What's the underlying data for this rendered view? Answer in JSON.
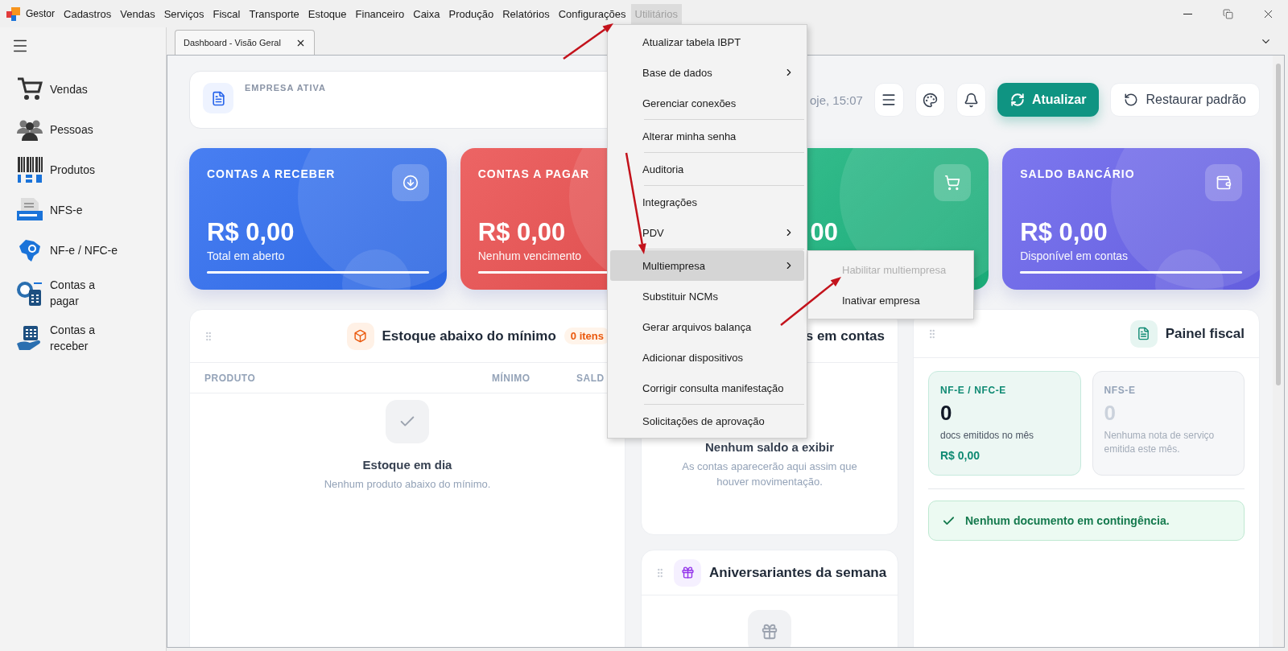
{
  "window": {
    "app_name": "Gestor"
  },
  "menu_bar": [
    {
      "label": "Cadastros",
      "selected": false
    },
    {
      "label": "Vendas",
      "selected": false
    },
    {
      "label": "Serviços",
      "selected": false
    },
    {
      "label": "Fiscal",
      "selected": false
    },
    {
      "label": "Transporte",
      "selected": false
    },
    {
      "label": "Estoque",
      "selected": false
    },
    {
      "label": "Financeiro",
      "selected": false
    },
    {
      "label": "Caixa",
      "selected": false
    },
    {
      "label": "Produção",
      "selected": false
    },
    {
      "label": "Relatórios",
      "selected": false
    },
    {
      "label": "Configurações",
      "selected": false
    },
    {
      "label": "Utilitários",
      "selected": true
    }
  ],
  "sidebar": {
    "items": [
      {
        "kind": "cart",
        "label": "Vendas"
      },
      {
        "kind": "people",
        "label": "Pessoas"
      },
      {
        "kind": "barcode",
        "label": "Produtos"
      },
      {
        "kind": "nfse",
        "label": "NFS-e"
      },
      {
        "kind": "nfe",
        "label": "NF-e / NFC-e"
      },
      {
        "kind": "payable",
        "label": "Contas a pagar"
      },
      {
        "kind": "receivable",
        "label": "Contas a receber"
      }
    ]
  },
  "tabs": [
    {
      "label": "Dashboard - Visão Geral",
      "selected": true
    }
  ],
  "header": {
    "label": "EMPRESA ATIVA",
    "date": "oje, 15:07",
    "buttons": [
      {
        "kind": "menu"
      },
      {
        "kind": "palette"
      },
      {
        "kind": "bell"
      },
      {
        "kind": "primary",
        "label": "Atualizar"
      },
      {
        "kind": "secondary",
        "label": "Restaurar padrão"
      }
    ]
  },
  "kpis": [
    {
      "title": "CONTAS A RECEBER",
      "value": "R$ 0,00",
      "subtitle": "Total em aberto",
      "kind": "download",
      "color": "#2f6df0",
      "level": 1
    },
    {
      "title": "CONTAS A PAGAR",
      "value": "R$ 0,00",
      "subtitle": "Nenhum vencimento",
      "kind": "plain",
      "color": "#ea4f4f",
      "level": 1
    },
    {
      "value": "00",
      "kind": "cart",
      "color": "#1cb57f",
      "obscured": true
    },
    {
      "title": "SALDO BANCÁRIO",
      "value": "R$ 0,00",
      "subtitle": "Disponível em contas",
      "kind": "wallet",
      "color": "#6a64ec",
      "level": 1
    }
  ],
  "stock_panel": {
    "title": "Estoque abaixo do mínimo",
    "badge": "0 itens",
    "columns": [
      "PRODUTO",
      "MÍNIMO",
      "SALD"
    ],
    "empty_title": "Estoque em dia",
    "empty_text": "Nenhum produto abaixo do mínimo."
  },
  "balances_panel": {
    "title": "s em contas",
    "empty_title": "Nenhum saldo a exibir",
    "empty_text": "As contas aparecerão aqui assim que houver movimentação."
  },
  "birthdays_panel": {
    "title": "Aniversariantes da semana"
  },
  "fiscal_panel": {
    "title": "Painel fiscal",
    "boxes": [
      {
        "title": "NF-E / NFC-E",
        "count": "0",
        "text": "docs emitidos no mês",
        "amount": "R$ 0,00",
        "active": true
      },
      {
        "title": "NFS-E",
        "count": "0",
        "text": "Nenhuma nota de serviço emitida este mês.",
        "active": false
      }
    ],
    "alert": "Nenhum documento em contingência."
  },
  "menu": {
    "items": [
      {
        "kind": "item",
        "label": "Atualizar tabela IBPT",
        "has_submenu": false,
        "selected": false
      },
      {
        "kind": "item",
        "label": "Base de dados",
        "has_submenu": true,
        "selected": false
      },
      {
        "kind": "item",
        "label": "Gerenciar conexões",
        "has_submenu": false,
        "selected": false
      },
      {
        "kind": "separator"
      },
      {
        "kind": "item",
        "label": "Alterar minha senha",
        "has_submenu": false,
        "selected": false
      },
      {
        "kind": "separator"
      },
      {
        "kind": "item",
        "label": "Auditoria",
        "has_submenu": false,
        "selected": false
      },
      {
        "kind": "separator"
      },
      {
        "kind": "item",
        "label": "Integrações",
        "has_submenu": false,
        "selected": false
      },
      {
        "kind": "item",
        "label": "PDV",
        "has_submenu": true,
        "selected": false
      },
      {
        "kind": "separator"
      },
      {
        "kind": "item",
        "label": "Multiempresa",
        "has_submenu": true,
        "selected": true
      },
      {
        "kind": "item",
        "label": "Substituir NCMs",
        "has_submenu": false,
        "selected": false
      },
      {
        "kind": "item",
        "label": "Gerar arquivos balança",
        "has_submenu": false,
        "selected": false
      },
      {
        "kind": "item",
        "label": "Adicionar dispositivos",
        "has_submenu": false,
        "selected": false
      },
      {
        "kind": "item",
        "label": "Corrigir consulta manifestação",
        "has_submenu": false,
        "selected": false
      },
      {
        "kind": "separator"
      },
      {
        "kind": "item",
        "label": "Solicitações de aprovação",
        "has_submenu": false,
        "selected": false
      }
    ]
  },
  "submenu": {
    "items": [
      {
        "label": "Habilitar multiempresa",
        "disabled": true
      },
      {
        "label": "Inativar empresa",
        "disabled": false
      }
    ]
  }
}
